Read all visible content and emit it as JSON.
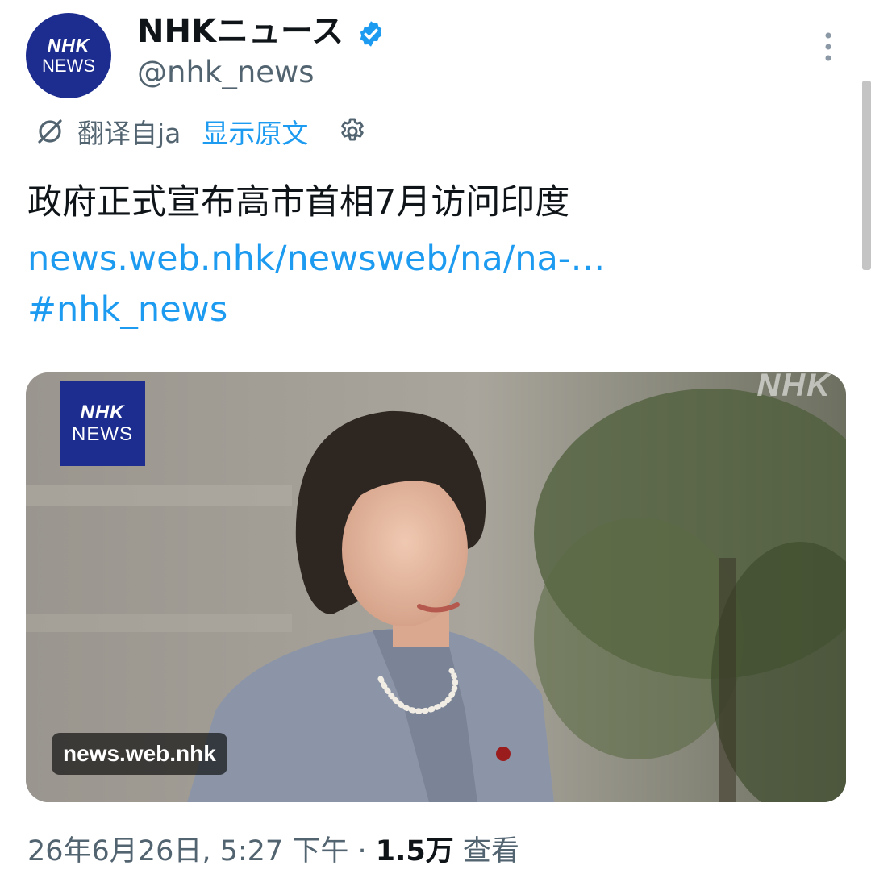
{
  "author": {
    "avatar_line1": "NHK",
    "avatar_line2": "NEWS",
    "display_name": "NHKニュース",
    "handle": "@nhk_news",
    "verified_icon": "verified-badge-icon"
  },
  "translation": {
    "translated_from": "翻译自ja",
    "show_original": "显示原文",
    "icon": "translate-icon",
    "settings_icon": "gear-icon"
  },
  "tweet": {
    "text": "政府正式宣布高市首相7月访问印度",
    "link": "news.web.nhk/newsweb/na/na-…",
    "hashtag": "#nhk_news"
  },
  "media": {
    "logo_line1": "NHK",
    "logo_line2": "NEWS",
    "watermark": "NHK",
    "source": "news.web.nhk"
  },
  "meta": {
    "datetime": "26年6月26日, 5:27 下午",
    "separator": "·",
    "views_count": "1.5万",
    "views_label": "查看"
  },
  "colors": {
    "accent": "#1d9bf0",
    "secondary_text": "#536471",
    "primary_text": "#0f1419",
    "nhk_blue": "#1d2d8f"
  }
}
